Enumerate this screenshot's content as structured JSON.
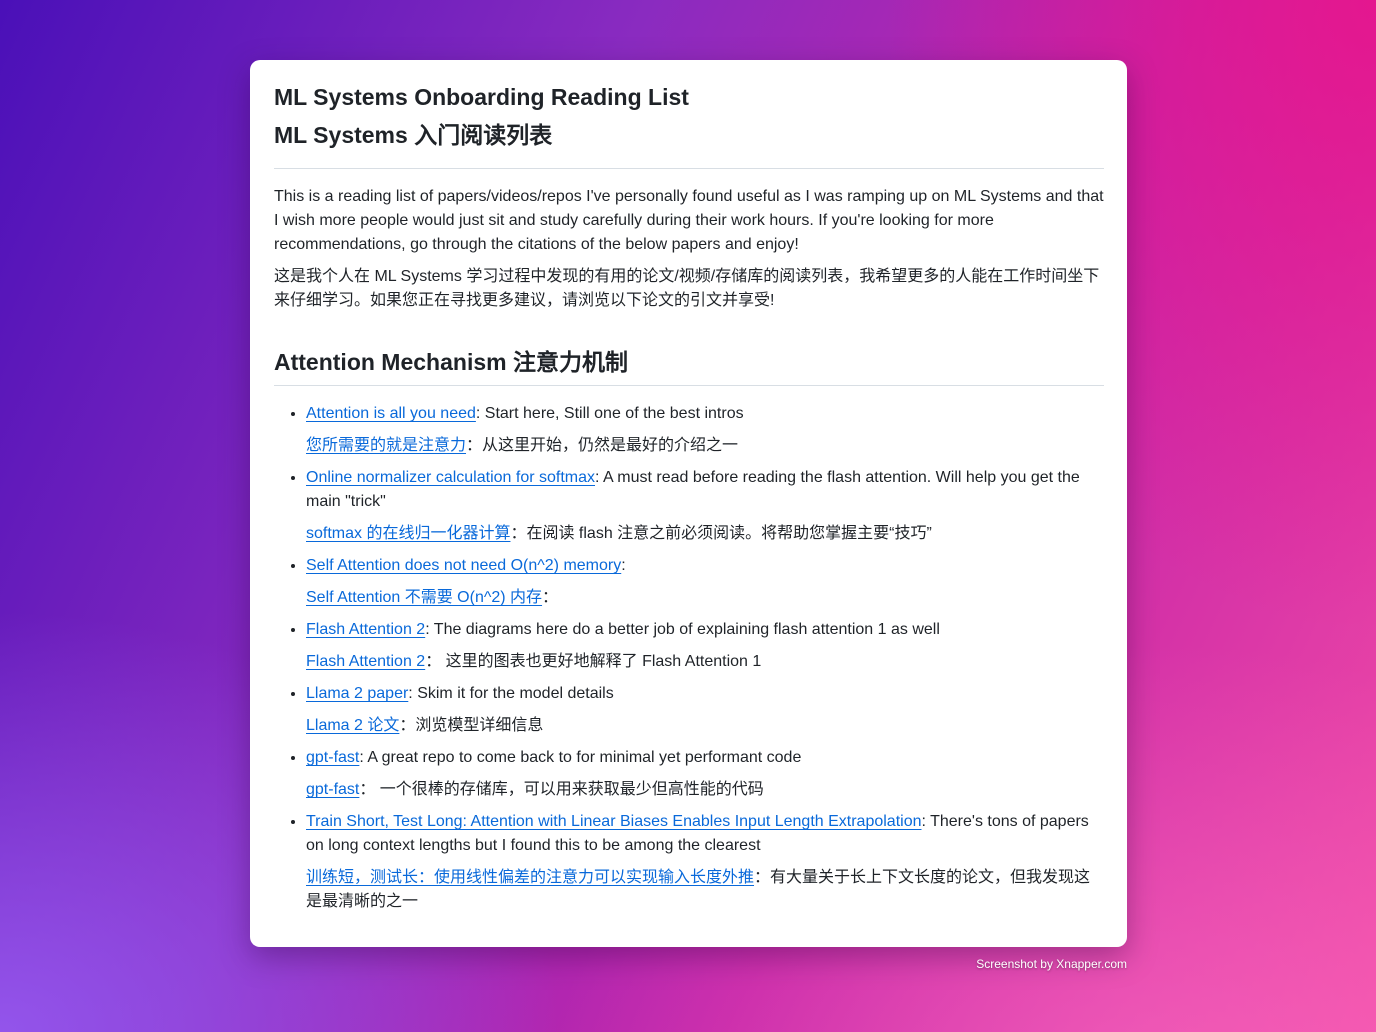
{
  "header": {
    "title_en": "ML Systems Onboarding Reading List",
    "title_zh": "ML Systems 入门阅读列表"
  },
  "intro": {
    "en": "This is a reading list of papers/videos/repos I've personally found useful as I was ramping up on ML Systems and that I wish more people would just sit and study carefully during their work hours. If you're looking for more recommendations, go through the citations of the below papers and enjoy!",
    "zh": "这是我个人在 ML Systems 学习过程中发现的有用的论文/视频/存储库的阅读列表，我希望更多的人能在工作时间坐下来仔细学习。如果您正在寻找更多建议，请浏览以下论文的引文并享受!"
  },
  "section": {
    "heading": "Attention Mechanism 注意力机制"
  },
  "items": [
    {
      "link_en": "Attention is all you need",
      "desc_en": ": Start here, Still one of the best intros",
      "link_zh": "您所需要的就是注意力",
      "desc_zh": "：从这里开始，仍然是最好的介绍之一"
    },
    {
      "link_en": "Online normalizer calculation for softmax",
      "desc_en": ": A must read before reading the flash attention. Will help you get the main \"trick\"",
      "link_zh": "softmax 的在线归一化器计算",
      "desc_zh": "：在阅读 flash 注意之前必须阅读。将帮助您掌握主要“技巧”"
    },
    {
      "link_en": "Self Attention does not need O(n^2) memory",
      "desc_en": ":",
      "link_zh": "Self Attention 不需要 O(n^2) 内存",
      "desc_zh": "："
    },
    {
      "link_en": "Flash Attention 2",
      "desc_en": ": The diagrams here do a better job of explaining flash attention 1 as well",
      "link_zh": "Flash Attention 2",
      "desc_zh": "： 这里的图表也更好地解释了 Flash Attention 1"
    },
    {
      "link_en": "Llama 2 paper",
      "desc_en": ": Skim it for the model details",
      "link_zh": "Llama 2 论文",
      "desc_zh": "：浏览模型详细信息"
    },
    {
      "link_en": "gpt-fast",
      "desc_en": ": A great repo to come back to for minimal yet performant code",
      "link_zh": "gpt-fast",
      "desc_zh": "： 一个很棒的存储库，可以用来获取最少但高性能的代码"
    },
    {
      "link_en": "Train Short, Test Long: Attention with Linear Biases Enables Input Length Extrapolation",
      "desc_en": ": There's tons of papers on long context lengths but I found this to be among the clearest",
      "link_zh": "训练短，测试长：使用线性偏差的注意力可以实现输入长度外推",
      "desc_zh": "：有大量关于长上下文长度的论文，但我发现这是最清晰的之一"
    }
  ],
  "footer": {
    "watermark": "Screenshot by Xnapper.com"
  },
  "colors": {
    "link": "#0969da",
    "text": "#1f2328",
    "divider": "#d8dee4"
  }
}
